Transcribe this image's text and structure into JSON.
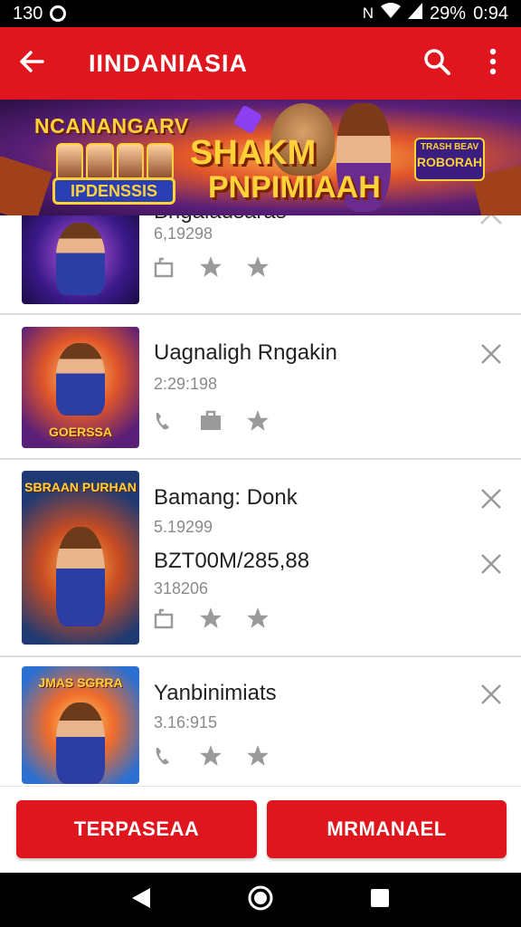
{
  "status_bar": {
    "time_left": "130",
    "battery": "29%",
    "clock": "0:94"
  },
  "app_bar": {
    "title": "IINDANIASIA",
    "back_icon": "arrow-left-icon",
    "search_icon": "search-icon",
    "menu_icon": "more-vert-icon"
  },
  "banner": {
    "left_title": "NCANANGARV",
    "ribbon": "IPDENSSIS",
    "main_line1": "SHAKM",
    "main_line2": "PNPIMIAAH",
    "badge_top": "TRASH BEAV",
    "badge_main": "ROBORAH"
  },
  "games": [
    {
      "name": "Brigaiausaras",
      "meta": "6,19298",
      "thumb_caption": "",
      "actions": [
        "bag-icon",
        "star-icon",
        "star-icon"
      ],
      "dismiss_icon": "chevron-up-icon"
    },
    {
      "name": "Uagnaligh Rngakin",
      "meta": "2:29:198",
      "thumb_caption": "GOERSSA",
      "actions": [
        "phone-icon",
        "bag-icon",
        "star-icon"
      ],
      "dismiss_icon": "close-icon"
    },
    {
      "name": "Bamang: Donk",
      "meta": "5.19299",
      "extra": "BZT00M/285,88",
      "meta2": "318206",
      "thumb_caption": "SBRAAN PURHAN",
      "actions": [
        "bag-icon",
        "star-icon",
        "star-icon"
      ],
      "dismiss_icon": "close-icon",
      "dismiss_icon_2": "close-icon"
    },
    {
      "name": "Yanbinimiats",
      "meta": "3.16:915",
      "thumb_caption": "JMAS SGRRA",
      "actions": [
        "phone-icon",
        "star-icon",
        "star-icon"
      ],
      "dismiss_icon": "close-icon"
    }
  ],
  "bottom_actions": {
    "left_label": "TERPASEAA",
    "right_label": "MRMANAEL"
  },
  "colors": {
    "primary": "#e0161e",
    "text": "#222222",
    "meta": "#8a8a8a",
    "icon": "#9a9a9a"
  }
}
